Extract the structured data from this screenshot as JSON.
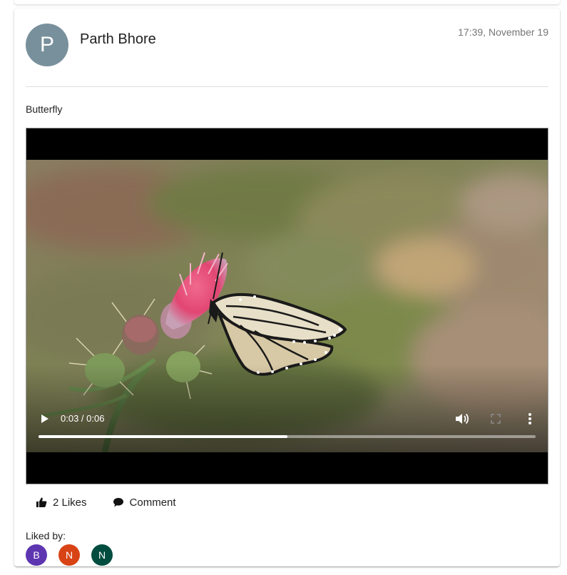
{
  "post": {
    "author": "Parth Bhore",
    "author_initial": "P",
    "timestamp": "17:39, November 19",
    "text": "Butterfly",
    "video": {
      "current_time": "0:03",
      "duration": "0:06",
      "time_display": "0:03 / 0:06",
      "progress": 0.5
    },
    "actions": {
      "likes_label": "2 Likes",
      "comment_label": "Comment"
    },
    "liked_by_label": "Liked by:",
    "likers": [
      {
        "initial": "B",
        "color": "#5e35b1"
      },
      {
        "initial": "N",
        "color": "#d84315"
      },
      {
        "initial": "N",
        "color": "#004d40"
      }
    ]
  },
  "colors": {
    "avatar": "#78909c"
  },
  "icons": {
    "like": "thumb-up-icon",
    "comment": "comment-icon",
    "play": "play-icon",
    "volume": "volume-icon",
    "fullscreen": "fullscreen-icon",
    "more": "more-vertical-icon"
  }
}
